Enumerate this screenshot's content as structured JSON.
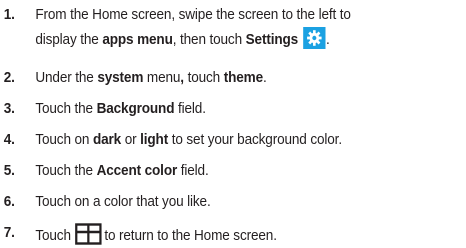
{
  "steps": [
    {
      "number": "1.",
      "line1": "From the Home screen, swipe the screen to the left to",
      "line2_a": "display the ",
      "line2_b": "apps menu",
      "line2_c": ", then touch ",
      "line2_d": "Settings",
      "line2_e": ".",
      "icon": "settings-gear-icon"
    },
    {
      "number": "2.",
      "a": "Under the ",
      "b": "system",
      "c": " menu",
      "d": ",",
      "e": " touch ",
      "f": "theme",
      "g": "."
    },
    {
      "number": "3.",
      "a": "Touch the ",
      "b": "Background",
      "c": " field."
    },
    {
      "number": "4.",
      "a": "Touch on ",
      "b": "dark",
      "c": " or ",
      "d": "light",
      "e": " to set your background color."
    },
    {
      "number": "5.",
      "a": "Touch the ",
      "b": "Accent color",
      "c": " field."
    },
    {
      "number": "6.",
      "a": "Touch on a color that you like."
    },
    {
      "number": "7.",
      "a": "Touch",
      "b": "to return to the Home screen.",
      "icon": "windows-start-icon"
    }
  ],
  "colors": {
    "text": "#231f20",
    "settings_tile": "#1ba1e2",
    "icon_stroke": "#231f20"
  }
}
